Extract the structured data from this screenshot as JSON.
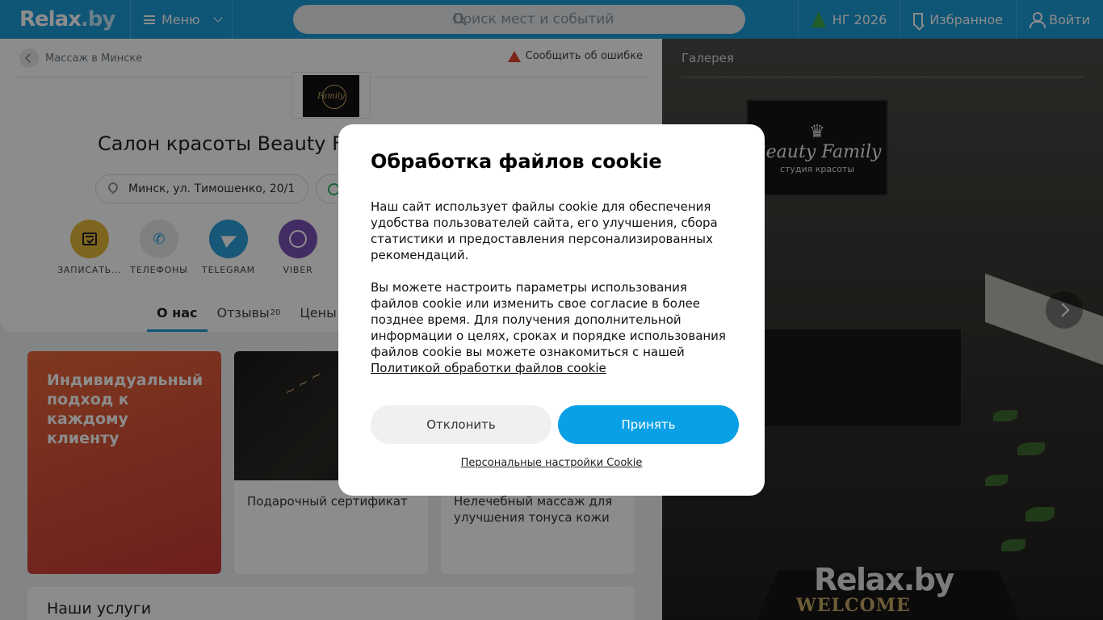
{
  "header": {
    "logo": "Relax",
    "logo_suffix": ".by",
    "menu_label": "Меню",
    "search_placeholder": "Поиск мест и событий",
    "ny_label": "НГ 2026",
    "favorites_label": "Избранное",
    "login_label": "Войти"
  },
  "breadcrumb": {
    "label": "Массаж в Минске"
  },
  "report_label": "Сообщить об ошибке",
  "salon": {
    "title": "Салон красоты Beauty F",
    "logo_text": "Family",
    "address": "Минск, ул. Тимошенко, 20/1"
  },
  "actions": [
    {
      "label": "ЗАПИСАТЬ...",
      "color": "#e6b83a",
      "icon": "calendar-icon"
    },
    {
      "label": "ТЕЛЕФОНЫ",
      "color": "#e6eaed",
      "icon": "phone-icon"
    },
    {
      "label": "TELEGRAM",
      "color": "#2a9fd9",
      "icon": "telegram-icon"
    },
    {
      "label": "VIBER",
      "color": "#7b4fb5",
      "icon": "viber-icon"
    }
  ],
  "tabs": [
    {
      "label": "О нас"
    },
    {
      "label": "Отзывы",
      "badge": "20"
    },
    {
      "label": "Цены"
    }
  ],
  "promo": {
    "text": "Индивидуальный подход к каждому клиенту"
  },
  "service_cards": [
    {
      "name": "Подарочный сертификат"
    },
    {
      "name": "Нелечебный массаж для улучшения тонуса кожи"
    }
  ],
  "services_heading": "Наши услуги",
  "gallery": {
    "label": "Галерея",
    "sign_brand": "Beauty Family",
    "sign_sub": "студия красоты",
    "mat_text": "WELCOME",
    "watermark": "Relax.by"
  },
  "cookie": {
    "title": "Обработка файлов cookie",
    "para1": "Наш сайт использует файлы cookie для обеспечения удобства пользователей сайта, его улучшения, сбора статистики и предоставления персонализированных рекомендаций.",
    "para2": "Вы можете настроить параметры использования файлов cookie или изменить свое согласие в более позднее время. Для получения дополнительной информации о целях, сроках и порядке использования файлов cookie вы можете ознакомиться с нашей",
    "policy_link": "Политикой обработки файлов cookie",
    "decline": "Отклонить",
    "accept": "Принять",
    "personal_settings": "Персональные настройки Cookie"
  },
  "colors": {
    "brand": "#1c9bd6",
    "accept": "#0aa0e6",
    "promo": "#d54f37"
  }
}
